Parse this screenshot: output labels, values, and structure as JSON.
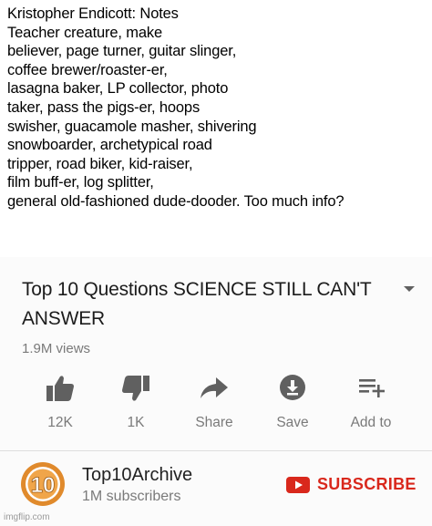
{
  "meme": {
    "caption": "Kristopher Endicott: Notes\nTeacher creature, make\nbeliever, page turner, guitar slinger,\ncoffee brewer/roaster-er,\nlasagna baker, LP collector, photo\ntaker, pass the pigs-er, hoops\nswisher, guacamole masher, shivering\nsnowboarder, archetypical road\ntripper, road biker, kid-raiser,\nfilm buff-er, log splitter,\ngeneral old-fashioned dude-dooder.  Too much info?"
  },
  "video": {
    "title": "Top 10 Questions SCIENCE STILL CAN'T ANSWER",
    "views": "1.9M views",
    "expand_icon": "chevron-down-icon"
  },
  "actions": [
    {
      "icon": "thumbs-up-icon",
      "label": "12K"
    },
    {
      "icon": "thumbs-down-icon",
      "label": "1K"
    },
    {
      "icon": "share-icon",
      "label": "Share"
    },
    {
      "icon": "save-icon",
      "label": "Save"
    },
    {
      "icon": "add-to-playlist-icon",
      "label": "Add to"
    }
  ],
  "channel": {
    "name": "Top10Archive",
    "subscribers": "1M subscribers",
    "logo_text": "10",
    "subscribe_label": "SUBSCRIBE"
  },
  "watermark": "imgflip.com",
  "colors": {
    "subscribe_red": "#d9281c",
    "logo_orange": "#e08a2c",
    "icon_gray": "#606060",
    "secondary_text": "#7a7a7a"
  }
}
